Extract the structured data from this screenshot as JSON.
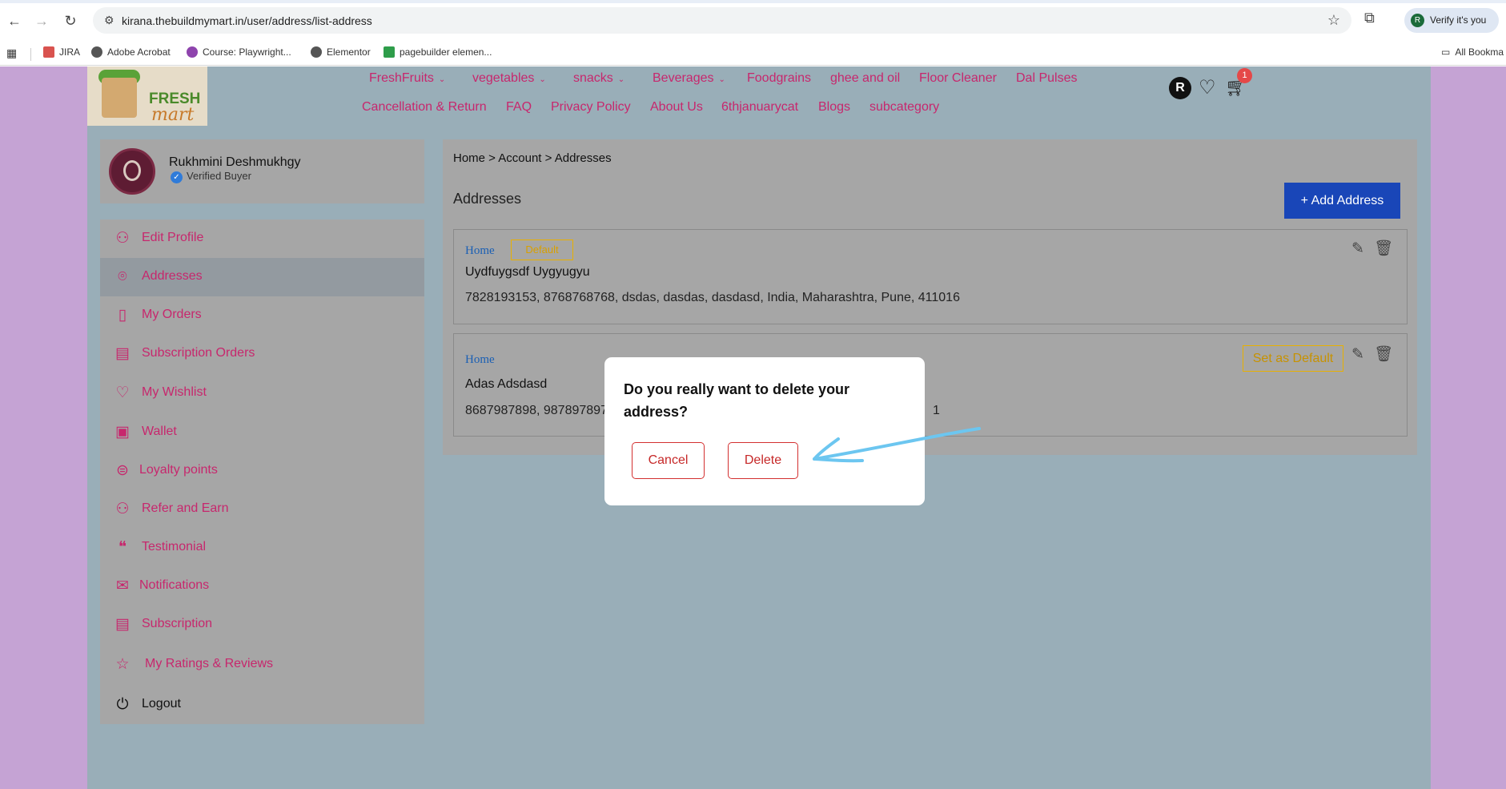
{
  "browser": {
    "url": "kirana.thebuildmymart.in/user/address/list-address",
    "verify_label": "Verify it's you",
    "avatar_letter": "R",
    "bookmarks": [
      "JIRA",
      "Adobe Acrobat",
      "Course: Playwright...",
      "Elementor",
      "pagebuilder elemen...",
      "All Bookma"
    ]
  },
  "logo": {
    "line1": "FRESH",
    "line2": "mart"
  },
  "menu": {
    "row1": [
      {
        "label": "FreshFruits",
        "caret": "⌄"
      },
      {
        "label": "vegetables",
        "caret": "⌄"
      },
      {
        "label": "snacks",
        "caret": "⌄"
      },
      {
        "label": "Beverages",
        "caret": "⌄"
      },
      {
        "label": "Foodgrains",
        "caret": ""
      },
      {
        "label": "ghee and oil",
        "caret": ""
      },
      {
        "label": "Floor Cleaner",
        "caret": ""
      },
      {
        "label": "Dal Pulses",
        "caret": ""
      }
    ],
    "row2": [
      "Cancellation & Return",
      "FAQ",
      "Privacy Policy",
      "About Us",
      "6thjanuarycat",
      "Blogs",
      "subcategory"
    ]
  },
  "header": {
    "user_initial": "R",
    "cart_count": "1"
  },
  "profile": {
    "name": "Rukhmini Deshmukhgy",
    "status": "Verified Buyer"
  },
  "sidebar": {
    "items": [
      {
        "label": "Edit Profile",
        "icon": "user-icon"
      },
      {
        "label": "Addresses",
        "icon": "location-icon"
      },
      {
        "label": "My Orders",
        "icon": "orders-icon"
      },
      {
        "label": "Subscription Orders",
        "icon": "calendar-icon"
      },
      {
        "label": "My Wishlist",
        "icon": "heart-icon"
      },
      {
        "label": "Wallet",
        "icon": "wallet-icon"
      },
      {
        "label": "Loyalty points",
        "icon": "coins-icon"
      },
      {
        "label": "Refer and Earn",
        "icon": "refer-icon"
      },
      {
        "label": "Testimonial",
        "icon": "quote-icon"
      },
      {
        "label": "Notifications",
        "icon": "bell-icon"
      },
      {
        "label": "Subscription",
        "icon": "subscription-icon"
      },
      {
        "label": "My Ratings & Reviews",
        "icon": "star-icon"
      },
      {
        "label": "Logout",
        "icon": "logout-icon"
      }
    ]
  },
  "main": {
    "breadcrumb": "Home > Account > Addresses",
    "title": "Addresses",
    "add_button": "+ Add Address",
    "addresses": [
      {
        "type": "Home",
        "badge": "Default",
        "name": "Uydfuygsdf Uygyugyu",
        "line": "7828193153, 8768768768, dsdas, dasdas, dasdasd, India, Maharashtra, Pune, 411016"
      },
      {
        "type": "Home",
        "set_default": "Set as Default",
        "name": "Adas Adsdasd",
        "line": "8687987898, 987897897",
        "line_tail": "1"
      }
    ]
  },
  "modal": {
    "question": "Do you really want to delete your address?",
    "cancel": "Cancel",
    "delete": "Delete"
  },
  "colors": {
    "accent": "#c7276d",
    "primary_button": "#1946b8",
    "default_badge": "#e8b000",
    "arrow": "#6cc6f0"
  }
}
